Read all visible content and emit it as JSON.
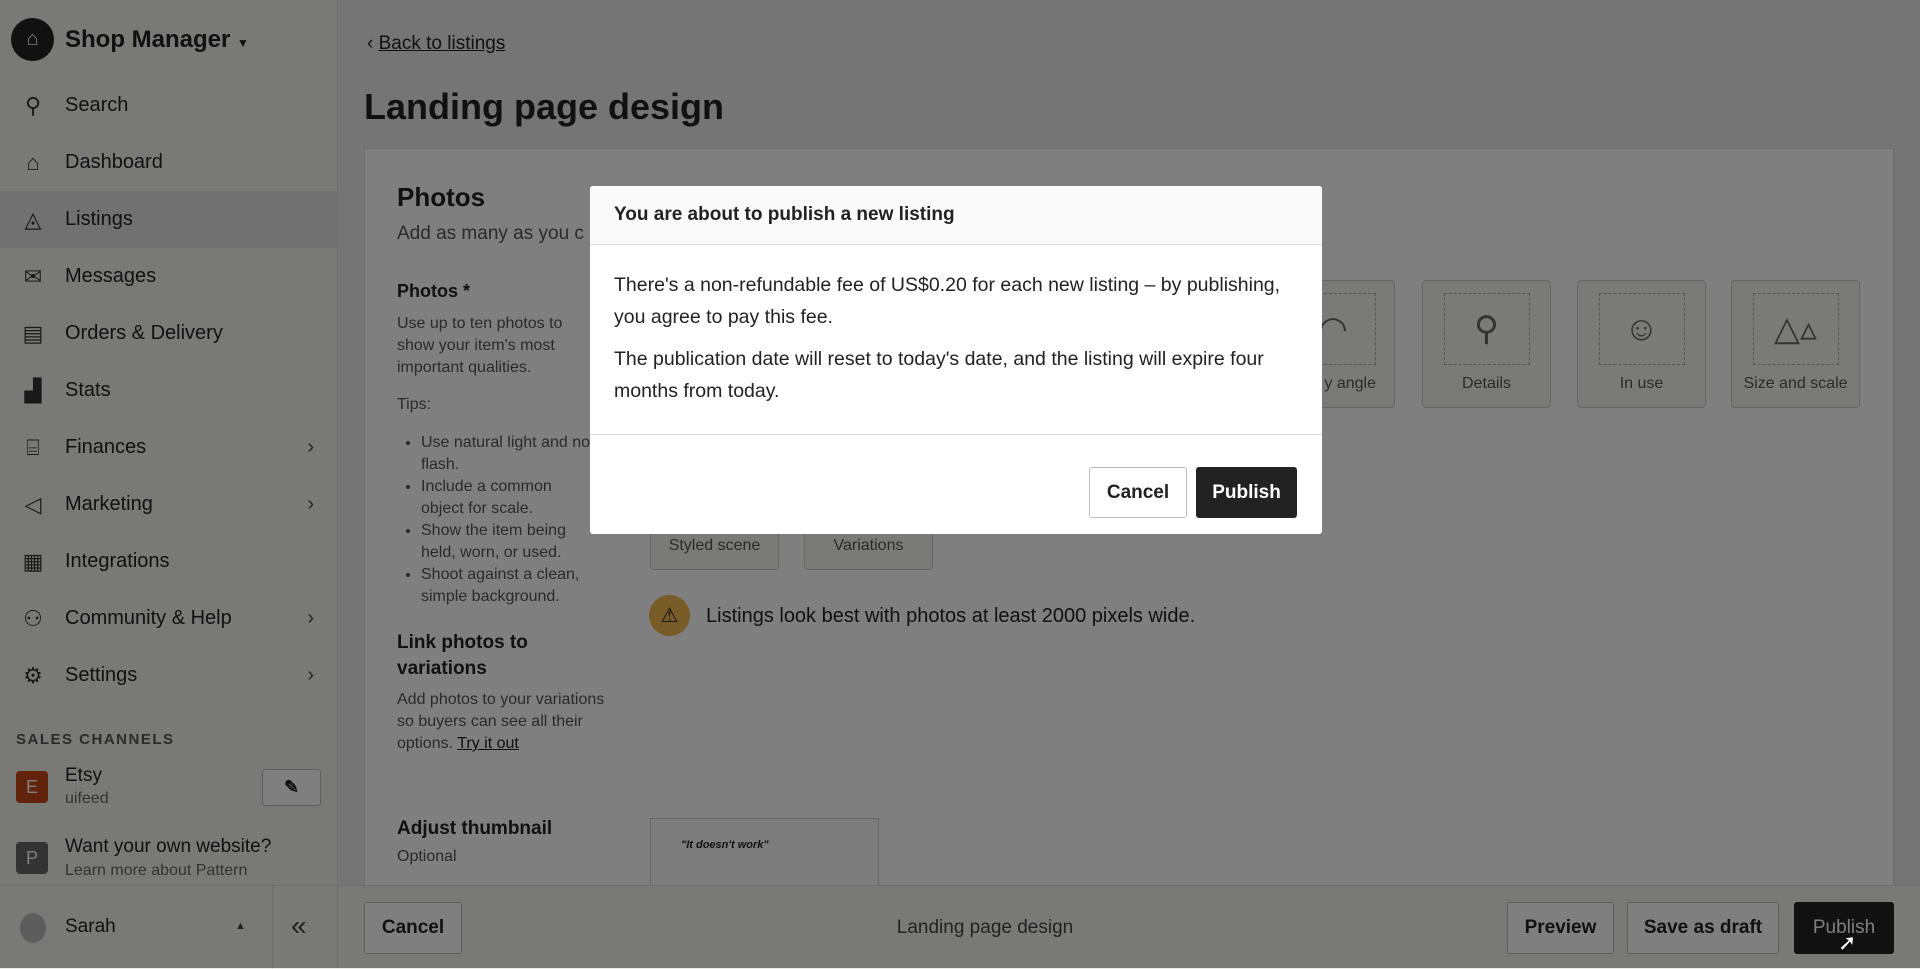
{
  "sidebar": {
    "brand": "Shop Manager",
    "items": [
      {
        "label": "Search",
        "icon": "search-icon"
      },
      {
        "label": "Dashboard",
        "icon": "home-icon"
      },
      {
        "label": "Listings",
        "icon": "shapes-icon",
        "active": true
      },
      {
        "label": "Messages",
        "icon": "mail-icon"
      },
      {
        "label": "Orders & Delivery",
        "icon": "clipboard-icon"
      },
      {
        "label": "Stats",
        "icon": "bar-chart-icon"
      },
      {
        "label": "Finances",
        "icon": "bank-icon",
        "has_submenu": true
      },
      {
        "label": "Marketing",
        "icon": "megaphone-icon",
        "has_submenu": true
      },
      {
        "label": "Integrations",
        "icon": "grid-icon"
      },
      {
        "label": "Community & Help",
        "icon": "people-icon",
        "has_submenu": true
      },
      {
        "label": "Settings",
        "icon": "gear-icon",
        "has_submenu": true
      }
    ],
    "sales_channels_label": "SALES CHANNELS",
    "etsy": {
      "badge": "E",
      "name": "Etsy",
      "shop": "uifeed",
      "color": "#c4461a"
    },
    "pattern": {
      "badge": "P",
      "title": "Want your own website?",
      "subtitle": "Learn more about Pattern"
    },
    "user": "Sarah"
  },
  "main": {
    "back_link": "Back to listings",
    "title": "Landing page design",
    "photos": {
      "heading": "Photos",
      "subtitle": "Add as many as you c",
      "label": "Photos *",
      "description": "Use up to ten photos to show your item's most important qualities.",
      "tips_label": "Tips:",
      "tips": [
        "Use natural light and no flash.",
        "Include a common object for scale.",
        "Show the item being held, worn, or used.",
        "Shoot against a clean, simple background."
      ],
      "tiles_row1": [
        "y angle",
        "Details",
        "In use",
        "Size and scale"
      ],
      "tiles_row2": [
        "Styled scene",
        "Variations"
      ],
      "warning": "Listings look best with photos at least 2000 pixels wide.",
      "link_heading": "Link photos to variations",
      "link_text": "Add photos to your variations so buyers can see all their options.",
      "link_cta": "Try it out",
      "thumb_heading": "Adjust thumbnail",
      "thumb_optional": "Optional",
      "thumb_preview_text": "\"It doesn't work\""
    }
  },
  "bottom_bar": {
    "cancel": "Cancel",
    "title": "Landing page design",
    "preview": "Preview",
    "save_draft": "Save as draft",
    "publish": "Publish"
  },
  "modal": {
    "title": "You are about to publish a new listing",
    "para1": "There's a non-refundable fee of US$0.20 for each new listing – by publishing, you agree to pay this fee.",
    "para2": "The publication date will reset to today's date, and the listing will expire four months from today.",
    "cancel": "Cancel",
    "publish": "Publish"
  }
}
